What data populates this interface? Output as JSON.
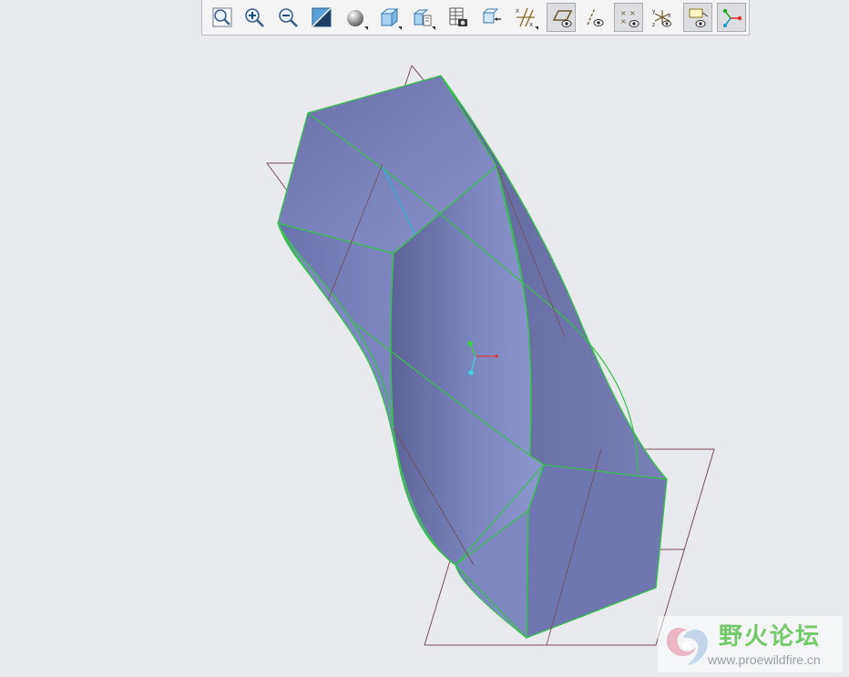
{
  "toolbar": {
    "buttons": [
      {
        "id": "refit",
        "icon": "refit-icon"
      },
      {
        "id": "zoom-in",
        "icon": "zoom-in-icon"
      },
      {
        "id": "zoom-out",
        "icon": "zoom-out-icon"
      },
      {
        "id": "repaint",
        "icon": "repaint-icon"
      },
      {
        "id": "display-style",
        "icon": "shading-icon",
        "dropdown": true
      },
      {
        "id": "saved-orientations",
        "icon": "saved-views-icon",
        "dropdown": true
      },
      {
        "id": "view-manager",
        "icon": "view-manager-icon",
        "dropdown": true
      },
      {
        "id": "section",
        "icon": "section-icon"
      },
      {
        "id": "spin-center",
        "icon": "spin-center-icon"
      },
      {
        "id": "datum-display-filters",
        "icon": "datum-filters-icon",
        "dropdown": true
      },
      {
        "id": "plane-display",
        "icon": "plane-display-icon",
        "active": true
      },
      {
        "id": "axis-display",
        "icon": "axis-display-icon"
      },
      {
        "id": "point-display",
        "icon": "point-display-icon",
        "active": true
      },
      {
        "id": "csys-display",
        "icon": "csys-display-icon"
      },
      {
        "id": "annotation-display",
        "icon": "annotation-display-icon",
        "active": true
      },
      {
        "id": "spin-center-display",
        "icon": "spin-center-display-icon",
        "active": true
      }
    ]
  },
  "model": {
    "face_color": "#7079b0",
    "edge_color": "#35c24a",
    "datum_plane_color": "#7a4f58"
  },
  "watermark": {
    "cn": "野火论坛",
    "url": "www.proewildfire.cn"
  }
}
